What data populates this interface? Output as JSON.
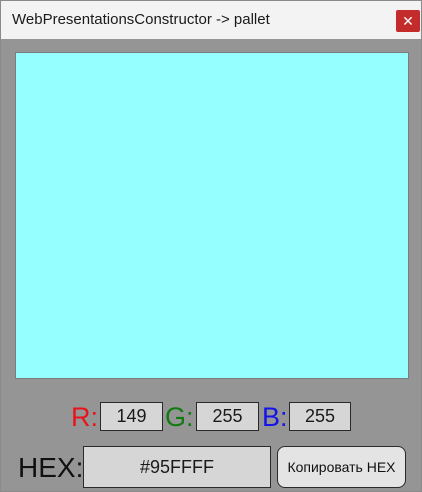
{
  "window": {
    "title": "WebPresentationsConstructor -> pallet",
    "close_glyph": "✕"
  },
  "preview": {
    "color": "#95FFFF"
  },
  "channels": {
    "r": {
      "label": "R:",
      "value": "149",
      "color": "#e8141b"
    },
    "g": {
      "label": "G:",
      "value": "255",
      "color": "#127a12"
    },
    "b": {
      "label": "B:",
      "value": "255",
      "color": "#1414e8"
    }
  },
  "hex": {
    "label": "HEX:",
    "value": "#95FFFF"
  },
  "copy_button": {
    "label": "Копировать HEX"
  }
}
